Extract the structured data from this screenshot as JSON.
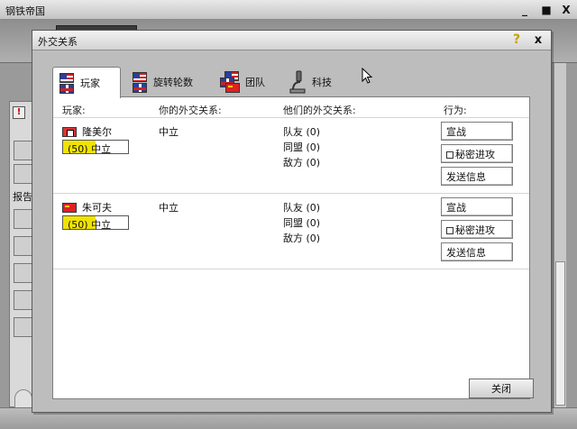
{
  "outer_window": {
    "title": "钢铁帝国",
    "minimize": "_",
    "maximize": "■",
    "close": "X"
  },
  "left_panel": {
    "alert": "!",
    "report_label": "报告"
  },
  "dialog": {
    "title": "外交关系",
    "help": "?",
    "close": "x",
    "tabs": [
      {
        "label": "玩家",
        "active": true
      },
      {
        "label": "旋转轮数",
        "active": false
      },
      {
        "label": "团队",
        "active": false
      },
      {
        "label": "科技",
        "active": false
      }
    ],
    "headers": {
      "player": "玩家:",
      "your_relation": "你的外交关系:",
      "their_relation": "他们的外交关系:",
      "action": "行为:"
    },
    "players": [
      {
        "name": "隆美尔",
        "flag": "germany",
        "relation_value": 50,
        "relation_text": "(50)  中立",
        "your_relation": "中立",
        "ally": "队友  (0)",
        "alliance": "同盟  (0)",
        "enemy": "敌方  (0)",
        "actions": {
          "declare_war": "宣战",
          "secret_attack": "秘密进攻",
          "send_message": "发送信息"
        }
      },
      {
        "name": "朱可夫",
        "flag": "ussr",
        "relation_value": 50,
        "relation_text": "(50)  中立",
        "your_relation": "中立",
        "ally": "队友  (0)",
        "alliance": "同盟  (0)",
        "enemy": "敌方  (0)",
        "actions": {
          "declare_war": "宣战",
          "secret_attack": "秘密进攻",
          "send_message": "发送信息"
        }
      }
    ],
    "close_button": "关闭"
  },
  "colors": {
    "relation_fill": "#f0e300",
    "panel_bg": "#ffffff",
    "dialog_bg": "#bdbdbd"
  }
}
